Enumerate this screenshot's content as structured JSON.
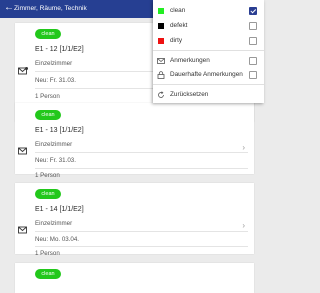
{
  "header": {
    "back_icon": "arrow-left",
    "title": "Zimmer, Räume, Technik"
  },
  "cards": [
    {
      "status": "clean",
      "room": "E1 - 12 [1/1/E2]",
      "type": "Einzelzimmer",
      "date": "Neu: Fr. 31.03.",
      "persons": "1 Person",
      "note_icon": "envelope-with-badge"
    },
    {
      "status": "clean",
      "room": "E1 - 13 [1/1/E2]",
      "type": "Einzelzimmer",
      "date": "Neu: Fr. 31.03.",
      "persons": "1 Person",
      "note_icon": "envelope"
    },
    {
      "status": "clean",
      "room": "E1 - 14 [1/1/E2]",
      "type": "Einzelzimmer",
      "date": "Neu: Mo. 03.04.",
      "persons": "1 Person",
      "note_icon": "envelope"
    },
    {
      "status": "clean"
    }
  ],
  "filter_menu": {
    "statuses": [
      {
        "label": "clean",
        "color": "#22ee22",
        "checked": true
      },
      {
        "label": "defekt",
        "color": "#000000",
        "checked": false
      },
      {
        "label": "dirty",
        "color": "#ee1111",
        "checked": false
      }
    ],
    "annotations": {
      "label": "Anmerkungen",
      "icon": "envelope",
      "checked": false
    },
    "permanent_annotations": {
      "label": "Dauerhafte Anmerkungen",
      "icon": "lock",
      "checked": false
    },
    "reset": {
      "label": "Zurücksetzen",
      "icon": "refresh"
    }
  },
  "colors": {
    "header": "#263f92",
    "badge": "#22c81b",
    "checkbox_active": "#2a3e92"
  }
}
